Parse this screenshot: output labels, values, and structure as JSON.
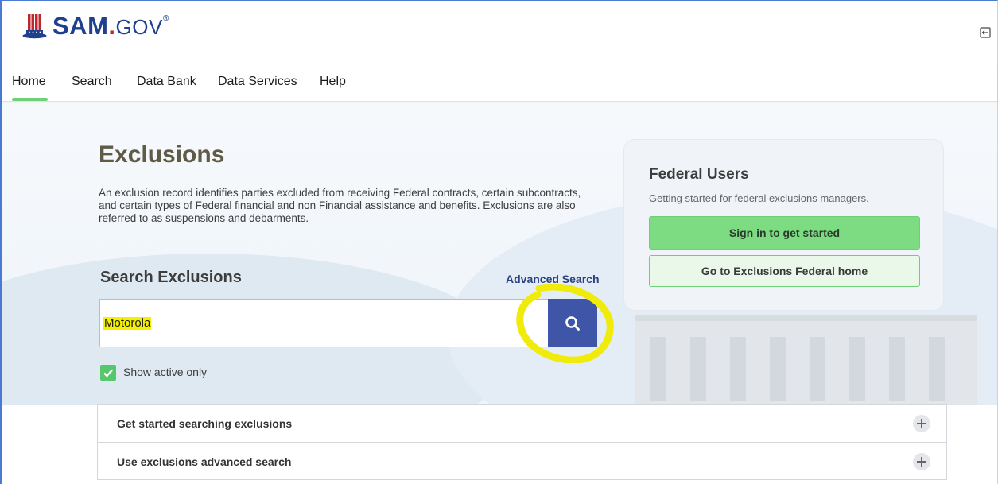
{
  "header": {
    "logo_text": "SAM",
    "logo_dot": ".",
    "logo_gov": "GOV",
    "logo_reg": "®"
  },
  "nav": {
    "items": [
      {
        "label": "Home",
        "active": true
      },
      {
        "label": "Search"
      },
      {
        "label": "Data Bank"
      },
      {
        "label": "Data Services"
      },
      {
        "label": "Help"
      }
    ]
  },
  "main": {
    "title": "Exclusions",
    "description": "An exclusion record identifies parties excluded from receiving Federal contracts, certain subcontracts, and certain types of Federal financial and non Financial assistance and benefits. Exclusions are also referred to as suspensions and debarments.",
    "search_heading": "Search Exclusions",
    "advanced_link": "Advanced Search",
    "search_value": "Motorola",
    "show_active_label": "Show active only"
  },
  "federal": {
    "title": "Federal Users",
    "subtitle": "Getting started for federal exclusions managers.",
    "signin_label": "Sign in to get started",
    "home_label": "Go to Exclusions Federal home"
  },
  "accordion": {
    "items": [
      {
        "label": "Get started searching exclusions"
      },
      {
        "label": "Use exclusions advanced search"
      }
    ]
  },
  "colors": {
    "brand_blue": "#1f3f8f",
    "search_button": "#3f56a8",
    "green": "#7ddb82",
    "highlight": "#f4f000"
  }
}
